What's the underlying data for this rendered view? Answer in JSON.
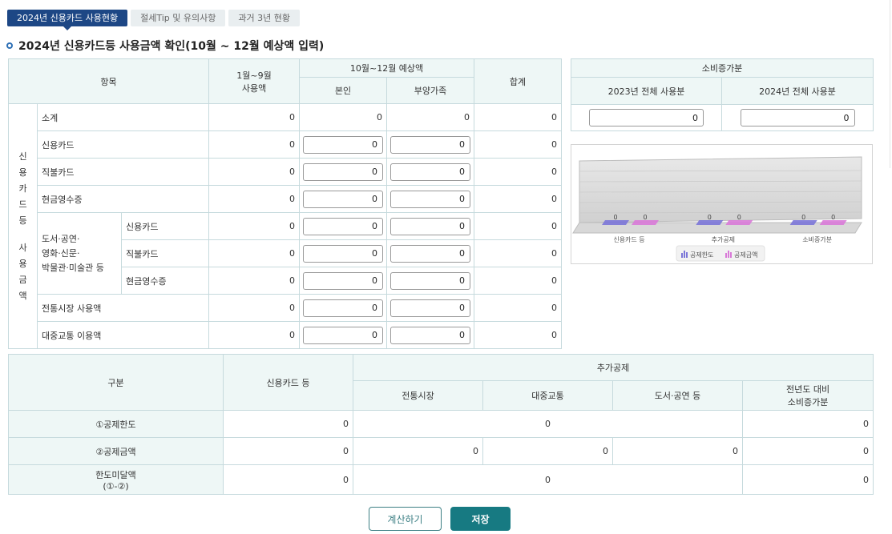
{
  "tabs": [
    {
      "label": "2024년 신용카드 사용현황",
      "active": true
    },
    {
      "label": "절세Tip 및 유의사항",
      "active": false
    },
    {
      "label": "과거 3년 현황",
      "active": false
    }
  ],
  "section_title": "2024년 신용카드등 사용금액 확인(10월 ~ 12월 예상액 입력)",
  "main_table": {
    "headers": {
      "item": "항목",
      "jan_sep_line1": "1월~9월",
      "jan_sep_line2": "사용액",
      "oct_dec": "10월~12월 예상액",
      "self": "본인",
      "dependents": "부양가족",
      "total": "합계"
    },
    "vertical_label_top": [
      "신",
      "용",
      "카",
      "드",
      "등"
    ],
    "vertical_label_bottom": [
      "사",
      "용",
      "금",
      "액"
    ],
    "culture_group_label": [
      "도서·공연·",
      "영화·신문·",
      "박물관·미술관 등"
    ],
    "rows": [
      {
        "label": "소계",
        "jan_sep": "0",
        "self": "0",
        "dependents": "0",
        "total": "0"
      },
      {
        "label": "신용카드",
        "jan_sep": "0",
        "self": "0",
        "dependents": "0",
        "total": "0"
      },
      {
        "label": "직불카드",
        "jan_sep": "0",
        "self": "0",
        "dependents": "0",
        "total": "0"
      },
      {
        "label": "현금영수증",
        "jan_sep": "0",
        "self": "0",
        "dependents": "0",
        "total": "0"
      },
      {
        "label": "신용카드",
        "jan_sep": "0",
        "self": "0",
        "dependents": "0",
        "total": "0"
      },
      {
        "label": "직불카드",
        "jan_sep": "0",
        "self": "0",
        "dependents": "0",
        "total": "0"
      },
      {
        "label": "현금영수증",
        "jan_sep": "0",
        "self": "0",
        "dependents": "0",
        "total": "0"
      },
      {
        "label": "전통시장 사용액",
        "jan_sep": "0",
        "self": "0",
        "dependents": "0",
        "total": "0"
      },
      {
        "label": "대중교통 이용액",
        "jan_sep": "0",
        "self": "0",
        "dependents": "0",
        "total": "0"
      }
    ]
  },
  "sobi_table": {
    "title": "소비증가분",
    "col_2023": "2023년 전체 사용분",
    "col_2024": "2024년 전체 사용분",
    "value_2023": "0",
    "value_2024": "0"
  },
  "chart_data": {
    "type": "bar",
    "categories": [
      "신용카드 등",
      "추가공제",
      "소비증가분"
    ],
    "series": [
      {
        "name": "공제한도",
        "values": [
          0,
          0,
          0
        ],
        "color": "#7b76d8"
      },
      {
        "name": "공제금액",
        "values": [
          0,
          0,
          0
        ],
        "color": "#d97ad8"
      }
    ],
    "data_labels": [
      "0",
      "0",
      "0",
      "0",
      "0",
      "0"
    ],
    "legend_position": "bottom",
    "grid": true
  },
  "result_table": {
    "headers": {
      "category": "구분",
      "credit": "신용카드 등",
      "additional": "추가공제",
      "market": "전통시장",
      "transit": "대중교통",
      "culture": "도서·공연 등",
      "increase_line1": "전년도 대비",
      "increase_line2": "소비증가분"
    },
    "rows": [
      {
        "label": "①공제한도",
        "credit": "0",
        "additional_merged": "0",
        "increase": "0"
      },
      {
        "label": "②공제금액",
        "credit": "0",
        "market": "0",
        "transit": "0",
        "culture": "0",
        "increase": "0"
      },
      {
        "label_line1": "한도미달액",
        "label_line2": "(①-②)",
        "credit": "0",
        "additional_merged": "0",
        "increase": "0"
      }
    ]
  },
  "buttons": {
    "calculate": "계산하기",
    "save": "저장"
  },
  "colors": {
    "active_tab": "#1d4785",
    "header_bg": "#eef7f6",
    "border": "#c6dadd",
    "save_button": "#177a82"
  }
}
